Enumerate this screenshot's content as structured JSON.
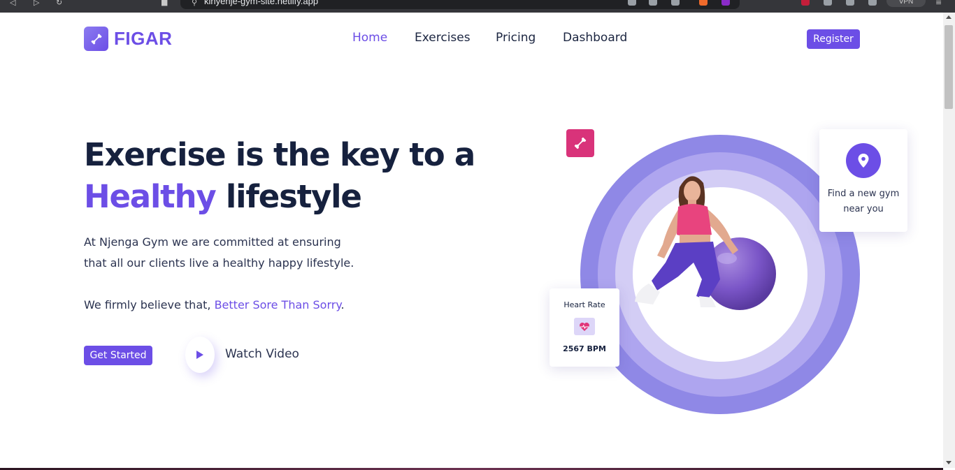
{
  "browser": {
    "url": "kinyenje-gym-site.netlify.app",
    "vpn_label": "VPN"
  },
  "brand": {
    "name": "FIGAR",
    "logo_icon": "dumbbell-icon",
    "accent_color": "#6c4ee6"
  },
  "nav": {
    "items": [
      {
        "label": "Home",
        "active": true
      },
      {
        "label": "Exercises",
        "active": false
      },
      {
        "label": "Pricing",
        "active": false
      },
      {
        "label": "Dashboard",
        "active": false
      }
    ],
    "register_label": "Register"
  },
  "hero": {
    "title_line1": "Exercise is the key to a",
    "title_accent": "Healthy",
    "title_rest": " lifestyle",
    "para1_line1": "At Njenga Gym we are committed at ensuring",
    "para1_line2": "that all our clients live a healthy happy lifestyle.",
    "para2_prefix": "We firmly believe that, ",
    "para2_accent": "Better Sore Than Sorry",
    "para2_suffix": ".",
    "cta_label": "Get Started",
    "watch_label": "Watch Video"
  },
  "cards": {
    "gym": {
      "icon": "location-pin-icon",
      "text": "Find a new gym near you"
    },
    "heart_rate": {
      "title": "Heart Rate",
      "icon": "heart-pulse-icon",
      "value": "2567 BPM"
    }
  },
  "badges": {
    "pink_icon": "dumbbell-icon",
    "pink_color": "#d9337a"
  }
}
